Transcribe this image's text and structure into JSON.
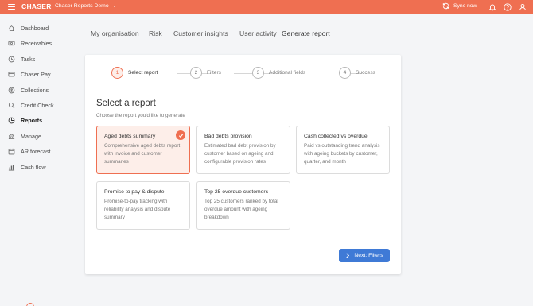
{
  "app": {
    "logo": "CHASER",
    "org_name": "Chaser Reports Demo",
    "sync_label": "Sync now"
  },
  "sidebar": {
    "items": [
      {
        "label": "Dashboard",
        "icon": "home-icon"
      },
      {
        "label": "Receivables",
        "icon": "cash-icon"
      },
      {
        "label": "Tasks",
        "icon": "clock-icon"
      },
      {
        "label": "Chaser Pay",
        "icon": "card-icon"
      },
      {
        "label": "Collections",
        "icon": "collections-icon"
      },
      {
        "label": "Credit Check",
        "icon": "search-icon"
      },
      {
        "label": "Reports",
        "icon": "reports-icon"
      },
      {
        "label": "Manage",
        "icon": "manage-icon"
      },
      {
        "label": "AR forecast",
        "icon": "calendar-icon"
      },
      {
        "label": "Cash flow",
        "icon": "bar-chart-icon"
      }
    ],
    "active": "Reports"
  },
  "tabs": [
    {
      "label": "My organisation"
    },
    {
      "label": "Risk"
    },
    {
      "label": "Customer insights"
    },
    {
      "label": "User activity"
    },
    {
      "label": "Generate report"
    }
  ],
  "active_tab": "Generate report",
  "stepper": [
    {
      "num": "1",
      "label": "Select report"
    },
    {
      "num": "2",
      "label": "Filters"
    },
    {
      "num": "3",
      "label": "Additional fields"
    },
    {
      "num": "4",
      "label": "Success"
    }
  ],
  "main": {
    "heading": "Select a report",
    "subheading": "Choose the report you'd like to generate",
    "reports": [
      {
        "title": "Aged debts summary",
        "desc": "Comprehensive aged debts report with invoice and customer summaries",
        "selected": true
      },
      {
        "title": "Bad debts provision",
        "desc": "Estimated bad debt provision by customer based on ageing and configurable provision rates",
        "selected": false
      },
      {
        "title": "Cash collected vs overdue",
        "desc": "Paid vs outstanding trend analysis with ageing buckets by customer, quarter, and month",
        "selected": false
      },
      {
        "title": "Promise to pay & dispute",
        "desc": "Promise-to-pay tracking with reliability analysis and dispute summary",
        "selected": false
      },
      {
        "title": "Top 25 overdue customers",
        "desc": "Top 25 customers ranked by total overdue amount with ageing breakdown",
        "selected": false
      }
    ],
    "next_button": "Next: Filters"
  },
  "colors": {
    "brand": "#ef6f51",
    "primary_button": "#3f7ad6",
    "selected_bg": "#fdeee9"
  }
}
